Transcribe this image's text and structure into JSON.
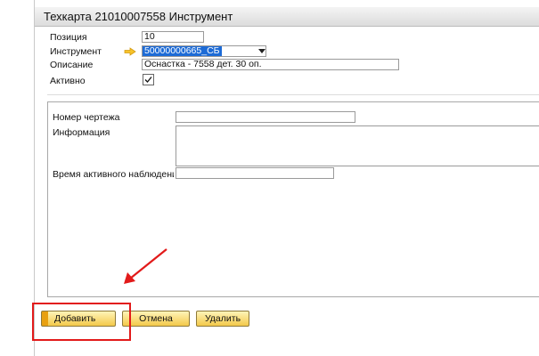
{
  "window": {
    "title": "Техкарта 21010007558 Инструмент"
  },
  "fields": {
    "position_label": "Позиция",
    "position_value": "10",
    "tool_label": "Инструмент",
    "tool_value": "50000000665_СБ",
    "description_label": "Описание",
    "description_value": "Оснастка - 7558 дет.  30 оп.",
    "active_label": "Активно",
    "active_checked": true
  },
  "details": {
    "drawing_label": "Номер чертежа",
    "drawing_value": "",
    "info_label": "Информация",
    "info_value": "",
    "observe_label": "Время активного наблюдени",
    "observe_value": ""
  },
  "buttons": {
    "add_label": "Добавить",
    "cancel_label": "Отмена",
    "delete_label": "Удалить"
  },
  "colors": {
    "button_gradient_top": "#fff4b8",
    "button_gradient_bottom": "#f3c94a",
    "selection": "#1d6bd6",
    "annotation_red": "#e21a1a"
  },
  "icons": {
    "link_arrow": "link-arrow-icon",
    "dropdown": "chevron-down-icon",
    "checkbox": "checkmark-icon"
  }
}
